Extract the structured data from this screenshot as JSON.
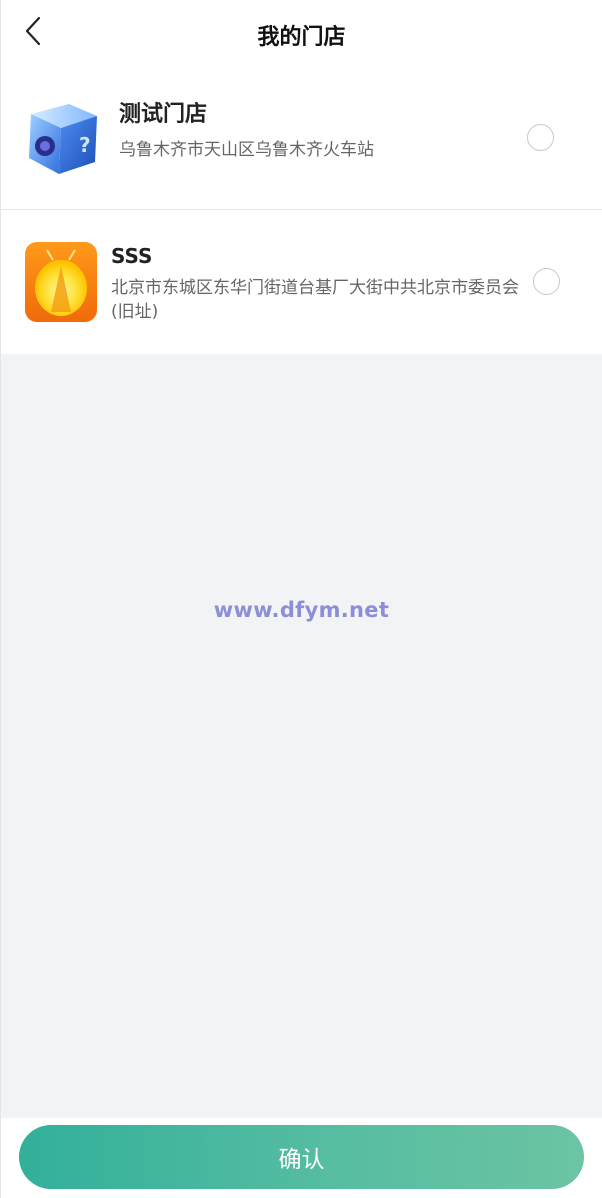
{
  "header": {
    "title": "我的门店"
  },
  "stores": [
    {
      "name": "测试门店",
      "address": "乌鲁木齐市天山区乌鲁木齐火车站",
      "selected": false
    },
    {
      "name": "SSS",
      "address": "北京市东城区东华门街道台基厂大街中共北京市委员会(旧址)",
      "selected": false
    }
  ],
  "watermark": "www.dfym.net",
  "footer": {
    "confirm_label": "确认"
  },
  "colors": {
    "accent_start": "#32b09a",
    "accent_end": "#6cc4a3",
    "background": "#f2f3f5"
  }
}
